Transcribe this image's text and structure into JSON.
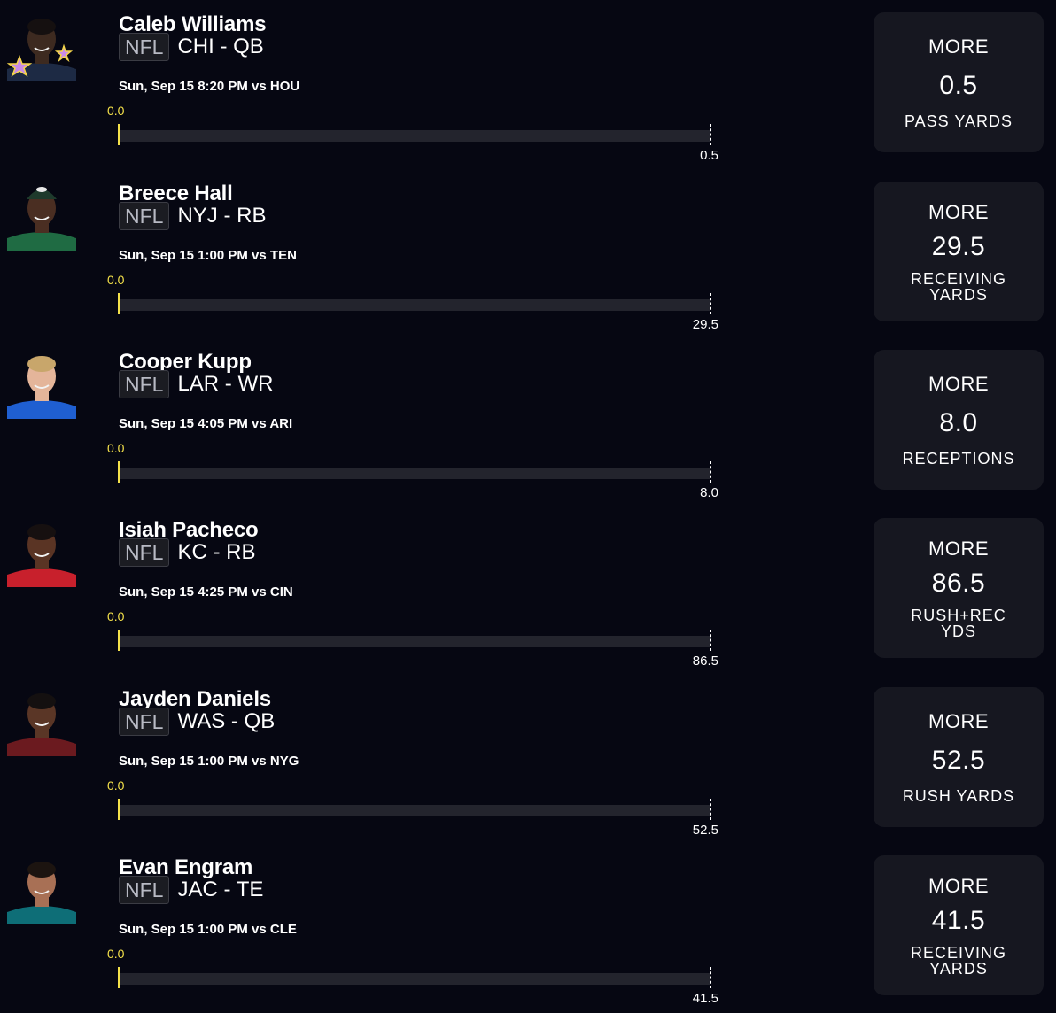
{
  "colors": {
    "background": "#060712",
    "card": "#161720",
    "track": "#23242d",
    "accent_yellow": "#f4e14a",
    "text": "#ffffff",
    "badge_text": "#b8bac4"
  },
  "players": [
    {
      "name": "Caleb Williams",
      "league": "NFL",
      "team_pos": "CHI - QB",
      "game_time": "Sun, Sep 15 8:20 PM  vs HOU",
      "start_value": "0.0",
      "progress": 0,
      "target_value": "0.5",
      "pick_label": "MORE",
      "line": "0.5",
      "stat": "PASS YARDS",
      "avatar": {
        "skin": "#3d2a20",
        "jersey": "#1d2a44",
        "hair": "#151010",
        "accessory": "star-icon"
      }
    },
    {
      "name": "Breece Hall",
      "league": "NFL",
      "team_pos": "NYJ - RB",
      "game_time": "Sun, Sep 15 1:00 PM  vs TEN",
      "start_value": "0.0",
      "progress": 0,
      "target_value": "29.5",
      "pick_label": "MORE",
      "line": "29.5",
      "stat": "RECEIVING YARDS",
      "avatar": {
        "skin": "#4a2e22",
        "jersey": "#1f6b43",
        "hair": "#1e3a2c",
        "accessory": "cap-icon"
      }
    },
    {
      "name": "Cooper Kupp",
      "league": "NFL",
      "team_pos": "LAR - WR",
      "game_time": "Sun, Sep 15 4:05 PM  vs ARI",
      "start_value": "0.0",
      "progress": 0,
      "target_value": "8.0",
      "pick_label": "MORE",
      "line": "8.0",
      "stat": "RECEPTIONS",
      "avatar": {
        "skin": "#e4b59a",
        "jersey": "#1f5fd1",
        "hair": "#c8a66b",
        "accessory": "none"
      }
    },
    {
      "name": "Isiah Pacheco",
      "league": "NFL",
      "team_pos": "KC - RB",
      "game_time": "Sun, Sep 15 4:25 PM  vs CIN",
      "start_value": "0.0",
      "progress": 0,
      "target_value": "86.5",
      "pick_label": "MORE",
      "line": "86.5",
      "stat": "RUSH+REC YDS",
      "avatar": {
        "skin": "#5a3424",
        "jersey": "#c8202c",
        "hair": "#161010",
        "accessory": "none"
      }
    },
    {
      "name": "Jayden Daniels",
      "league": "NFL",
      "team_pos": "WAS - QB",
      "game_time": "Sun, Sep 15 1:00 PM  vs NYG",
      "start_value": "0.0",
      "progress": 0,
      "target_value": "52.5",
      "pick_label": "MORE",
      "line": "52.5",
      "stat": "RUSH YARDS",
      "avatar": {
        "skin": "#5a3626",
        "jersey": "#6b1a1f",
        "hair": "#141010",
        "accessory": "none"
      }
    },
    {
      "name": "Evan Engram",
      "league": "NFL",
      "team_pos": "JAC - TE",
      "game_time": "Sun, Sep 15 1:00 PM  vs CLE",
      "start_value": "0.0",
      "progress": 0,
      "target_value": "41.5",
      "pick_label": "MORE",
      "line": "41.5",
      "stat": "RECEIVING YARDS",
      "avatar": {
        "skin": "#a87055",
        "jersey": "#0e6e77",
        "hair": "#1c1410",
        "accessory": "none"
      }
    }
  ]
}
